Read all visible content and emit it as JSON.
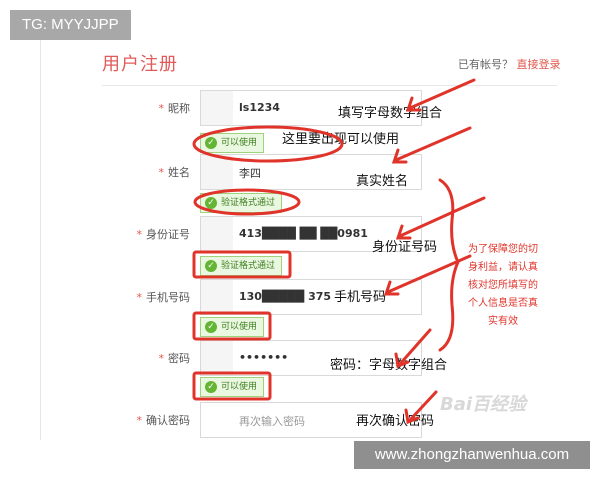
{
  "watermark_top": "TG: MYYJJPP",
  "watermark_bottom": "www.zhongzhanwenhua.com",
  "header": {
    "title": "用户注册",
    "have_account_text": "已有帐号？",
    "login_link": "直接登录"
  },
  "form": {
    "nickname": {
      "label": "昵称",
      "value": "ls1234",
      "status": "可以使用"
    },
    "name": {
      "label": "姓名",
      "value": "李四",
      "status": "验证格式通过"
    },
    "id_number": {
      "label": "身份证号",
      "value": "413████ ██ ██0981",
      "status": "验证格式通过"
    },
    "phone": {
      "label": "手机号码",
      "value": "130█████ 375",
      "status": "可以使用"
    },
    "password": {
      "label": "密码",
      "value": "•••••••",
      "status": "可以使用"
    },
    "confirm": {
      "label": "确认密码",
      "placeholder": "再次输入密码"
    }
  },
  "annotations": {
    "a1": "填写字母数字组合",
    "a2": "这里要出现可以使用",
    "a3": "真实姓名",
    "a4": "身份证号码",
    "a5": "手机号码",
    "a6": "密码：字母数字组合",
    "a7": "再次确认密码",
    "side_note": "为了保障您的切身利益，请认真核对您所填写的个人信息是否真实有效"
  },
  "colors": {
    "accent": "#e2574c",
    "annotation_red": "#e0342b",
    "valid_green": "#64b534"
  },
  "baidu_mark": "Bai百经验"
}
